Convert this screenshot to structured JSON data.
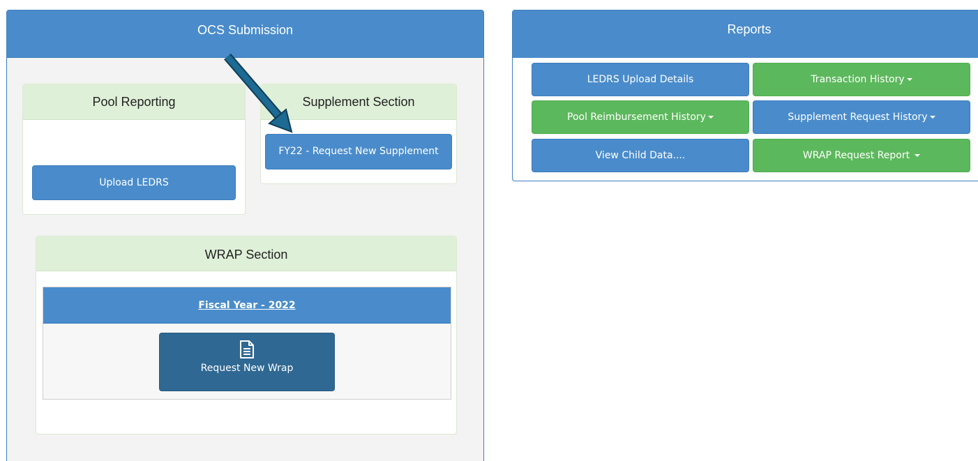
{
  "ocs": {
    "title": "OCS Submission",
    "pool": {
      "title": "Pool Reporting",
      "upload_button": "Upload LEDRS"
    },
    "supplement": {
      "title": "Supplement Section",
      "request_button": "FY22 - Request New Supplement"
    },
    "wrap": {
      "title": "WRAP Section",
      "fiscal_year_link": "Fiscal Year - 2022",
      "request_button": "Request New Wrap",
      "request_icon": "document-icon"
    },
    "annotation": {
      "arrow_color": "#1d6a93"
    }
  },
  "reports": {
    "title": "Reports",
    "buttons": [
      {
        "label": "LEDRS Upload Details",
        "color": "blue",
        "dropdown": false
      },
      {
        "label": "Transaction History",
        "color": "green",
        "dropdown": true
      },
      {
        "label": "Pool Reimbursement History",
        "color": "green",
        "dropdown": true
      },
      {
        "label": "Supplement Request History",
        "color": "blue",
        "dropdown": true
      },
      {
        "label": "View Child Data....",
        "color": "blue",
        "dropdown": false
      },
      {
        "label": "WRAP Request Report",
        "color": "green",
        "dropdown": true
      }
    ]
  },
  "colors": {
    "primary_blue": "#4a8ccb",
    "dark_blue": "#2f6893",
    "success_green": "#5cb85c",
    "section_header_green": "#dff0d8",
    "panel_background": "#f3f3f3"
  }
}
